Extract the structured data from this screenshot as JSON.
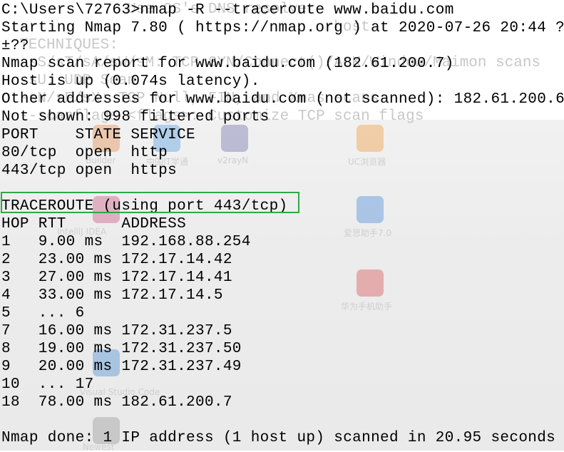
{
  "terminal": {
    "lines": [
      "C:\\Users\\72763>nmap -R --traceroute www.baidu.com",
      "Starting Nmap 7.80 ( https://nmap.org ) at 2020-07-26 20:44 ?",
      "±??",
      "Nmap scan report for www.baidu.com (182.61.200.7)",
      "Host is up (0.074s latency).",
      "Other addresses for www.baidu.com (not scanned): 182.61.200.6",
      "Not shown: 998 filtered ports",
      "PORT    STATE SERVICE",
      "80/tcp  open  http",
      "443/tcp open  https",
      "",
      "TRACEROUTE (using port 443/tcp)",
      "HOP RTT      ADDRESS",
      "1   9.00 ms  192.168.88.254",
      "2   23.00 ms 172.17.14.42",
      "3   27.00 ms 172.17.14.41",
      "4   33.00 ms 172.17.14.5",
      "5   ... 6",
      "7   16.00 ms 172.31.237.5",
      "8   19.00 ms 172.31.237.50",
      "9   20.00 ms 172.31.237.49",
      "10  ... 17",
      "18  78.00 ms 182.61.200.7",
      "",
      "Nmap done: 1 IP address (1 host up) scanned in 20.95 seconds"
    ]
  },
  "highlight": {
    "color": "#2ea84a"
  },
  "ghost": {
    "text_lines": [
      "              Use OS's DNS resolver",
      "                                    rhost",
      "  TECHNIQUES:",
      "  -sS/sT/sA/sW/sM: TCP SYN/Connect()/ACK/Window/Maimon scans",
      "  -sU: UDP Scan",
      "  -sN/sF/sX: TCP Null, FIN, and Xmas scans",
      "  --scanflags <flags>: Customize TCP scan flags"
    ],
    "desktop_labels": {
      "builder": "Builder",
      "kitten": "中国IT学通",
      "v2ray": "v2rayN",
      "uc": "UC浏览器",
      "idea": "IntelliJ IDEA",
      "aisi": "爱思助手7.0",
      "huawei": "华为手机助手",
      "vscode": "Visual Studio Code",
      "newest": "Newest"
    }
  }
}
